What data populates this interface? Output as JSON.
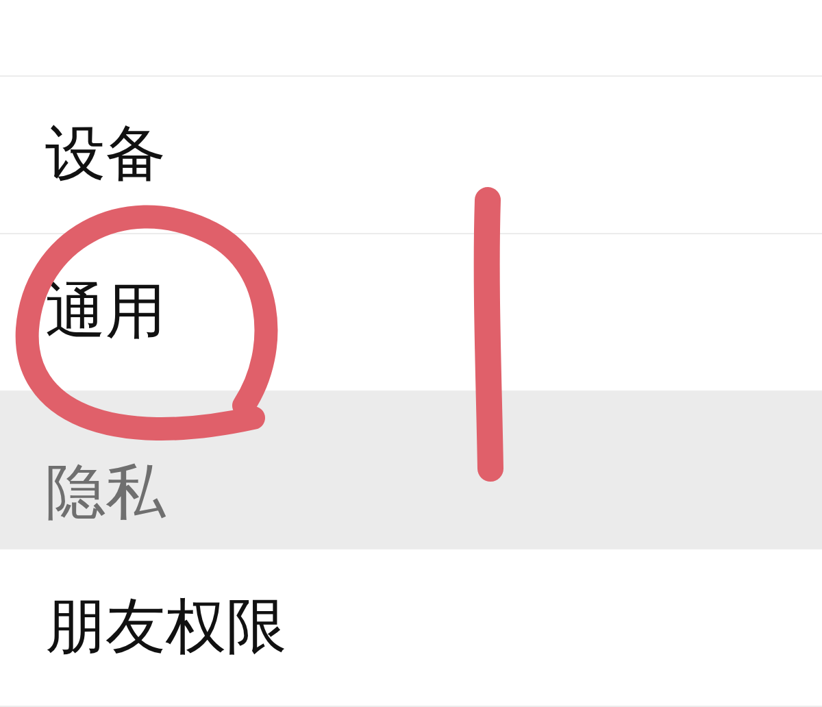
{
  "settings_items": [
    {
      "label": "设备",
      "pressed": false
    },
    {
      "label": "通用",
      "pressed": false
    },
    {
      "label": "隐私",
      "pressed": true
    },
    {
      "label": "朋友权限",
      "pressed": false
    }
  ]
}
